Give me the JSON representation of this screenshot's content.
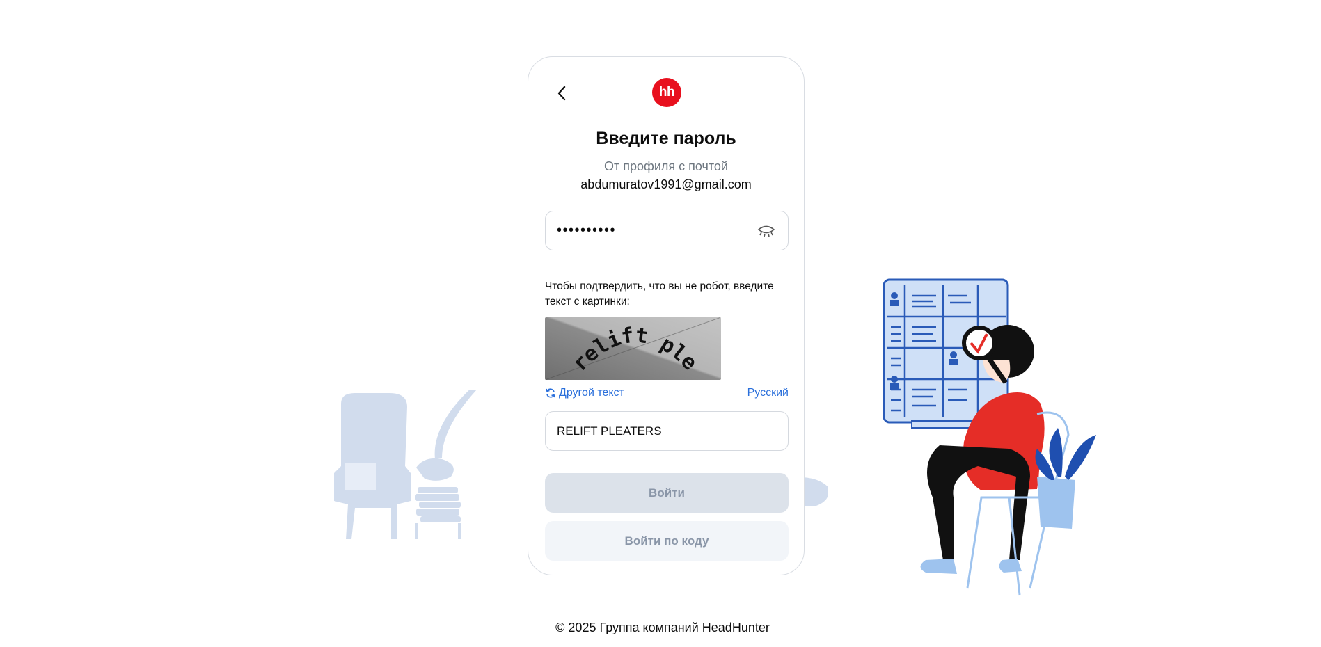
{
  "brand": {
    "logo_text": "hh",
    "accent": "#e8101e",
    "link_color": "#2a6fdb"
  },
  "header": {
    "back_icon": "chevron-left-icon"
  },
  "form": {
    "title": "Введите пароль",
    "subtitle": "От профиля с почтой",
    "email": "abdumuratov1991@gmail.com",
    "password_masked": "••••••••••",
    "eye_icon": "eye-closed-icon"
  },
  "captcha": {
    "prompt": "Чтобы подтвердить, что вы не робот, введите текст с картинки:",
    "image_text": "relift pleaters",
    "refresh_label": "Другой текст",
    "refresh_icon": "refresh-icon",
    "language_label": "Русский",
    "input_value": "RELIFT PLEATERS"
  },
  "buttons": {
    "login_label": "Войти",
    "login_code_label": "Войти по коду"
  },
  "footer": {
    "copyright": "© 2025 Группа компаний HeadHunter"
  }
}
